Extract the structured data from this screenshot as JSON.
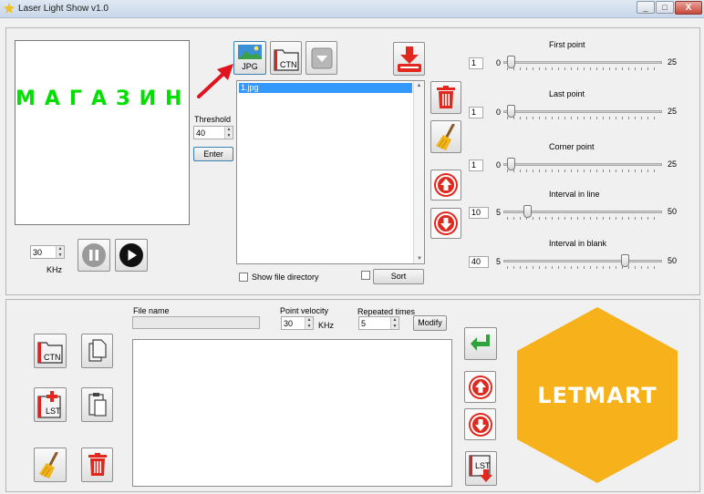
{
  "window": {
    "title": "Laser Light Show v1.0",
    "controls": [
      "_",
      "□",
      "X"
    ]
  },
  "preview": {
    "text": "МАГАЗИН"
  },
  "threshold": {
    "label": "Threshold",
    "value": "40",
    "enter_label": "Enter"
  },
  "speed": {
    "value": "30",
    "unit": "KHz"
  },
  "file_icons": {
    "jpg_label": "JPG",
    "ctn_label": "CTN"
  },
  "file_list": {
    "items": [
      "1.jpg"
    ]
  },
  "show_dir": {
    "label": "Show file directory",
    "checked": false
  },
  "sort": {
    "label": "Sort",
    "checked": false
  },
  "sliders": [
    {
      "label": "First point",
      "value": "1",
      "min": "0",
      "max": "25",
      "position": 0.0
    },
    {
      "label": "Last point",
      "value": "1",
      "min": "0",
      "max": "25",
      "position": 0.0
    },
    {
      "label": "Corner point",
      "value": "1",
      "min": "0",
      "max": "25",
      "position": 0.0
    },
    {
      "label": "Interval in line",
      "value": "10",
      "min": "5",
      "max": "50",
      "position": 0.11
    },
    {
      "label": "Interval in blank",
      "value": "40",
      "min": "5",
      "max": "50",
      "position": 0.78
    }
  ],
  "bottom": {
    "file_name_label": "File name",
    "file_name_value": "",
    "point_velocity_label": "Point velocity",
    "point_velocity_value": "30",
    "point_velocity_unit": "KHz",
    "repeated_label": "Repeated times",
    "repeated_value": "5",
    "modify_label": "Modify",
    "ctn_label": "CTN",
    "lst_label": "LST"
  },
  "logo": {
    "text": "LETMART",
    "color": "#f7b21b"
  },
  "colors": {
    "accent_red": "#e0281e",
    "selection": "#3399ff",
    "green_text": "#00e000"
  }
}
